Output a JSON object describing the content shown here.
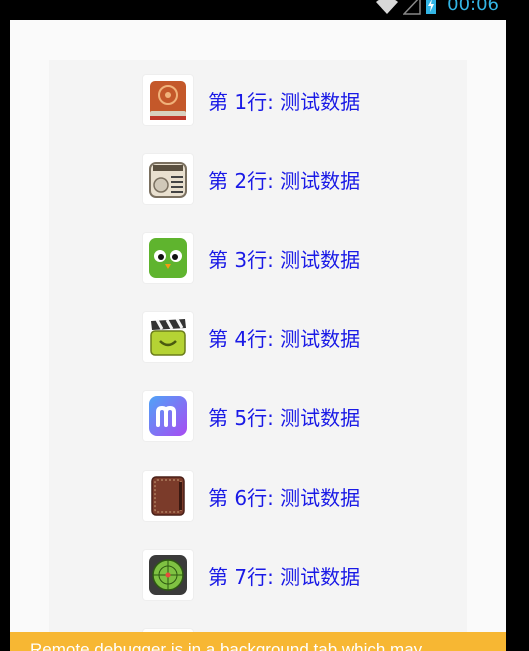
{
  "status_bar": {
    "time": "00:06",
    "icons": [
      "wifi-icon",
      "cellular-signal-icon",
      "battery-charging-icon"
    ],
    "accent_color": "#33b5e5"
  },
  "list": {
    "label_color": "#1a1ae6",
    "rows": [
      {
        "label": "第 1行: 测试数据",
        "icon": "notebook-app-icon"
      },
      {
        "label": "第 2行: 测试数据",
        "icon": "radio-app-icon"
      },
      {
        "label": "第 3行: 测试数据",
        "icon": "owl-app-icon"
      },
      {
        "label": "第 4行: 测试数据",
        "icon": "video-clapper-app-icon"
      },
      {
        "label": "第 5行: 测试数据",
        "icon": "letter-m-app-icon"
      },
      {
        "label": "第 6行: 测试数据",
        "icon": "leather-journal-app-icon"
      },
      {
        "label": "第 7行: 测试数据",
        "icon": "green-radar-app-icon"
      }
    ]
  },
  "toast": {
    "text": "Remote debugger is in a background tab which may",
    "background": "#f7b733"
  }
}
